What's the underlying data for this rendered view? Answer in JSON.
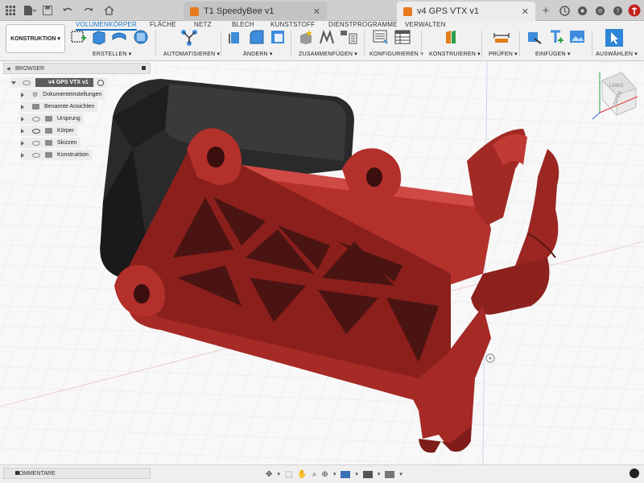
{
  "tabs": {
    "inactive": {
      "title": "T1 SpeedyBee v1"
    },
    "active": {
      "title": "v4 GPS VTX v1"
    }
  },
  "ribbon": {
    "workspace": "KONSTRUKTION",
    "tabs": [
      "VOLUMENKÖRPER",
      "FLÄCHE",
      "NETZ",
      "BLECH",
      "KUNSTSTOFF",
      "DIENSTPROGRAMME",
      "VERWALTEN"
    ],
    "groups": {
      "erstellen": "ERSTELLEN ▾",
      "automatisieren": "AUTOMATISIEREN ▾",
      "aendern": "ÄNDERN ▾",
      "zusammenfuegen": "ZUSAMMENFÜGEN ▾",
      "konfigurieren": "KONFIGURIEREN ▾",
      "konstruieren": "KONSTRUIEREN ▾",
      "pruefen": "PRÜFEN ▾",
      "einfuegen": "EINFÜGEN ▾",
      "auswaehlen": "AUSWÄHLEN ▾"
    }
  },
  "browser": {
    "title": "BROWSER",
    "root": "v4 GPS VTX v1",
    "items": [
      {
        "label": "Dokumenteinstellungen"
      },
      {
        "label": "Benannte Ansichten"
      },
      {
        "label": "Ursprung"
      },
      {
        "label": "Körper"
      },
      {
        "label": "Skizzen"
      },
      {
        "label": "Konstruktion"
      }
    ]
  },
  "viewcube": {
    "left": "LINKS",
    "bottom": "UNTEN"
  },
  "bottom": {
    "comments": "KOMMENTARE"
  },
  "colors": {
    "accent": "#1a73c4",
    "part": "#b0302a",
    "part_dark": "#7a1c19",
    "case": "#2a2a2a"
  }
}
